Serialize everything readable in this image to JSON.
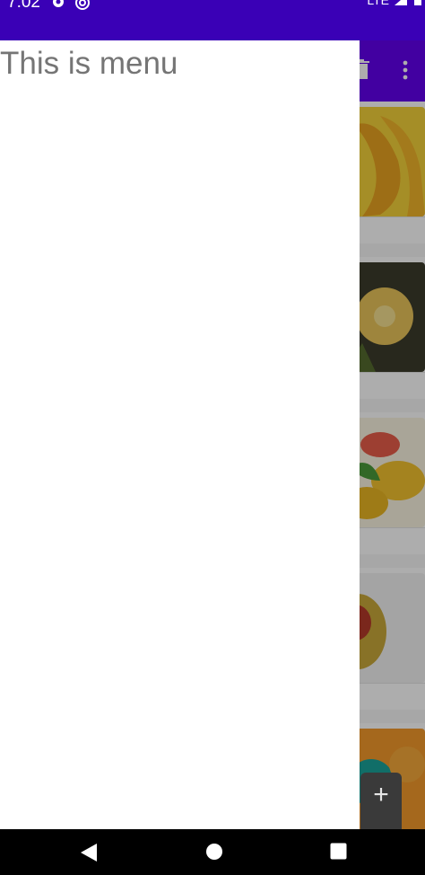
{
  "status_bar": {
    "time": "7:02",
    "network": "LTE",
    "icons": [
      "gear-icon",
      "at-sign-icon",
      "lte-signal-icon",
      "battery-icon"
    ],
    "background": "#3a00b6"
  },
  "app": {
    "toolbar_color": "#6200ee",
    "toolbar_icons": [
      "delete-icon",
      "more-vert-icon"
    ],
    "list_items": [
      {
        "image": "bananas"
      },
      {
        "image": "pineapple"
      },
      {
        "image": "mangoes"
      },
      {
        "image": "mango"
      },
      {
        "image": "oranges"
      }
    ]
  },
  "drawer": {
    "title": "This is menu"
  },
  "zoom_control": {
    "zoom_in": "+",
    "zoom_out": "−"
  },
  "nav_bar": {
    "buttons": [
      "back-icon",
      "home-icon",
      "recents-icon"
    ]
  }
}
